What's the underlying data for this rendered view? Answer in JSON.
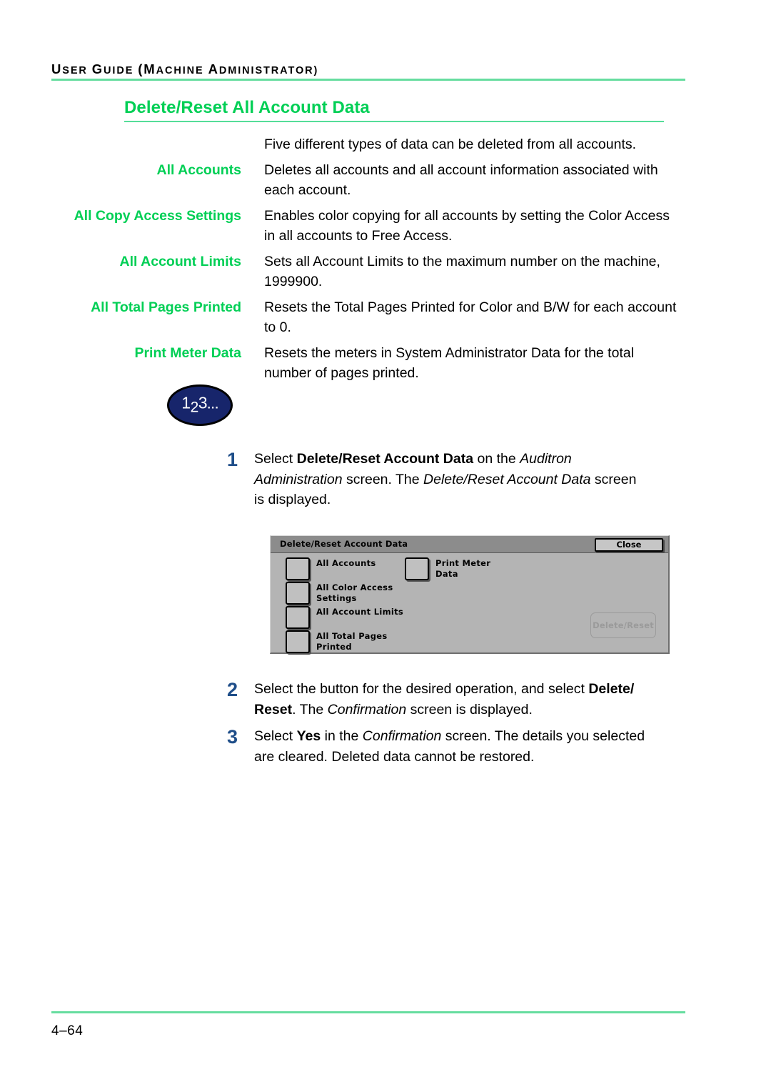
{
  "header": {
    "running_head": "USER GUIDE (MACHINE ADMINISTRATOR)",
    "rule_color": "#66dd9f"
  },
  "section": {
    "title": "Delete/Reset All Account Data",
    "title_color": "#00cf55"
  },
  "intro": {
    "term": "",
    "description": "Five different types of data can be deleted from all accounts."
  },
  "definitions": [
    {
      "term": "All Accounts",
      "description": "Deletes all accounts and all account information associated with each account."
    },
    {
      "term": "All Copy Access Settings",
      "description": "Enables color copying for all accounts by setting the Color Access in all accounts to Free Access."
    },
    {
      "term": "All Account Limits",
      "description": "Sets all Account Limits to the maximum number on the machine, 1999900."
    },
    {
      "term": "All Total Pages Printed",
      "description": "Resets the Total Pages Printed for Color and B/W for each account to 0."
    },
    {
      "term": "Print Meter Data",
      "description": "Resets the meters in System Administrator Data for the total number of pages printed."
    }
  ],
  "procedure_badge": {
    "digit1": "1",
    "digit2": "2",
    "digit3": "3...",
    "fill_color": "#17256b"
  },
  "steps": [
    {
      "number": "1",
      "segments": [
        {
          "text": "Select ",
          "style": "normal"
        },
        {
          "text": "Delete/Reset Account Data",
          "style": "bold"
        },
        {
          "text": " on the ",
          "style": "normal"
        },
        {
          "text": "Auditron Administration",
          "style": "italic"
        },
        {
          "text": " screen. The ",
          "style": "normal"
        },
        {
          "text": "Delete/Reset Account Data",
          "style": "italic"
        },
        {
          "text": " screen is displayed.",
          "style": "normal"
        }
      ]
    },
    {
      "number": "2",
      "segments": [
        {
          "text": "Select the button for the desired operation, and select ",
          "style": "normal"
        },
        {
          "text": "Delete/ Reset",
          "style": "bold"
        },
        {
          "text": ". The ",
          "style": "normal"
        },
        {
          "text": "Confirmation",
          "style": "italic"
        },
        {
          "text": " screen is displayed.",
          "style": "normal"
        }
      ]
    },
    {
      "number": "3",
      "segments": [
        {
          "text": "Select ",
          "style": "normal"
        },
        {
          "text": "Yes",
          "style": "bold"
        },
        {
          "text": " in the ",
          "style": "normal"
        },
        {
          "text": "Confirmation",
          "style": "italic"
        },
        {
          "text": " screen. The details you selected are cleared. Deleted data cannot be restored.",
          "style": "normal"
        }
      ]
    }
  ],
  "device_screen": {
    "title": "Delete/Reset Account Data",
    "close_label": "Close",
    "options_left": [
      {
        "label": "All Accounts"
      },
      {
        "label": "All Color Access\nSettings"
      },
      {
        "label": "All Account Limits"
      },
      {
        "label": "All Total Pages\nPrinted"
      }
    ],
    "options_right": [
      {
        "label": "Print Meter\nData"
      }
    ],
    "action_label": "Delete/Reset",
    "action_enabled": false
  },
  "footer": {
    "page_number": "4–64"
  }
}
